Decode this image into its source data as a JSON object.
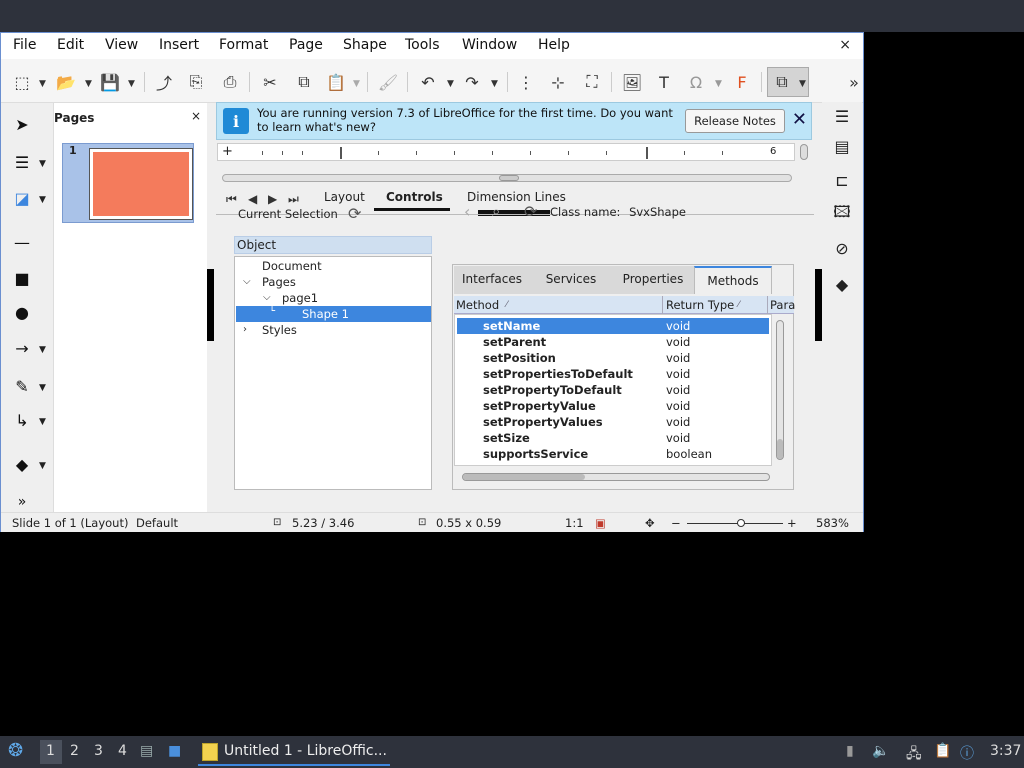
{
  "menubar": {
    "items": [
      "File",
      "Edit",
      "View",
      "Insert",
      "Format",
      "Page",
      "Shape",
      "Tools",
      "Window",
      "Help"
    ],
    "close_glyph": "×"
  },
  "pages_pane": {
    "title": "Pages",
    "close_glyph": "×",
    "slide_number": "1"
  },
  "infobar": {
    "message": "You are running version 7.3 of LibreOffice for the first time. Do you want to learn what's new?",
    "button": "Release Notes",
    "close_glyph": "✕"
  },
  "ruler": {
    "plus": "+",
    "label_6": "6"
  },
  "tabs": [
    "Layout",
    "Controls",
    "Dimension Lines"
  ],
  "inspector": {
    "current_selection": "Current Selection",
    "class_label": "Class name:",
    "class_name": "SvxShape",
    "object_header": "Object",
    "tree": [
      "Document",
      "Pages",
      "page1",
      "Shape 1",
      "Styles"
    ],
    "tabs": [
      "Interfaces",
      "Services",
      "Properties",
      "Methods"
    ],
    "columns": {
      "method": "Method",
      "return_type": "Return Type",
      "params": "Para"
    },
    "methods": [
      {
        "name": "setName",
        "type": "void"
      },
      {
        "name": "setParent",
        "type": "void"
      },
      {
        "name": "setPosition",
        "type": "void"
      },
      {
        "name": "setPropertiesToDefault",
        "type": "void"
      },
      {
        "name": "setPropertyToDefault",
        "type": "void"
      },
      {
        "name": "setPropertyValue",
        "type": "void"
      },
      {
        "name": "setPropertyValues",
        "type": "void"
      },
      {
        "name": "setSize",
        "type": "void"
      },
      {
        "name": "supportsService",
        "type": "boolean"
      }
    ]
  },
  "statusbar": {
    "slide": "Slide 1 of 1 (Layout)",
    "master": "Default",
    "position": "5.23 / 3.46",
    "size": "0.55 x 0.59",
    "scale": "1:1",
    "zoom_minus": "−",
    "zoom_plus": "+",
    "zoom": "583%"
  },
  "taskbar": {
    "workspaces": [
      "1",
      "2",
      "3",
      "4"
    ],
    "task_label": "Untitled 1 - LibreOffic...",
    "clock": "3:37"
  },
  "icons": {
    "app_menu": "menu-icon",
    "accent": "#3d86de",
    "shape_fill": "#f47b5c",
    "info_bg": "#bde5f8"
  }
}
